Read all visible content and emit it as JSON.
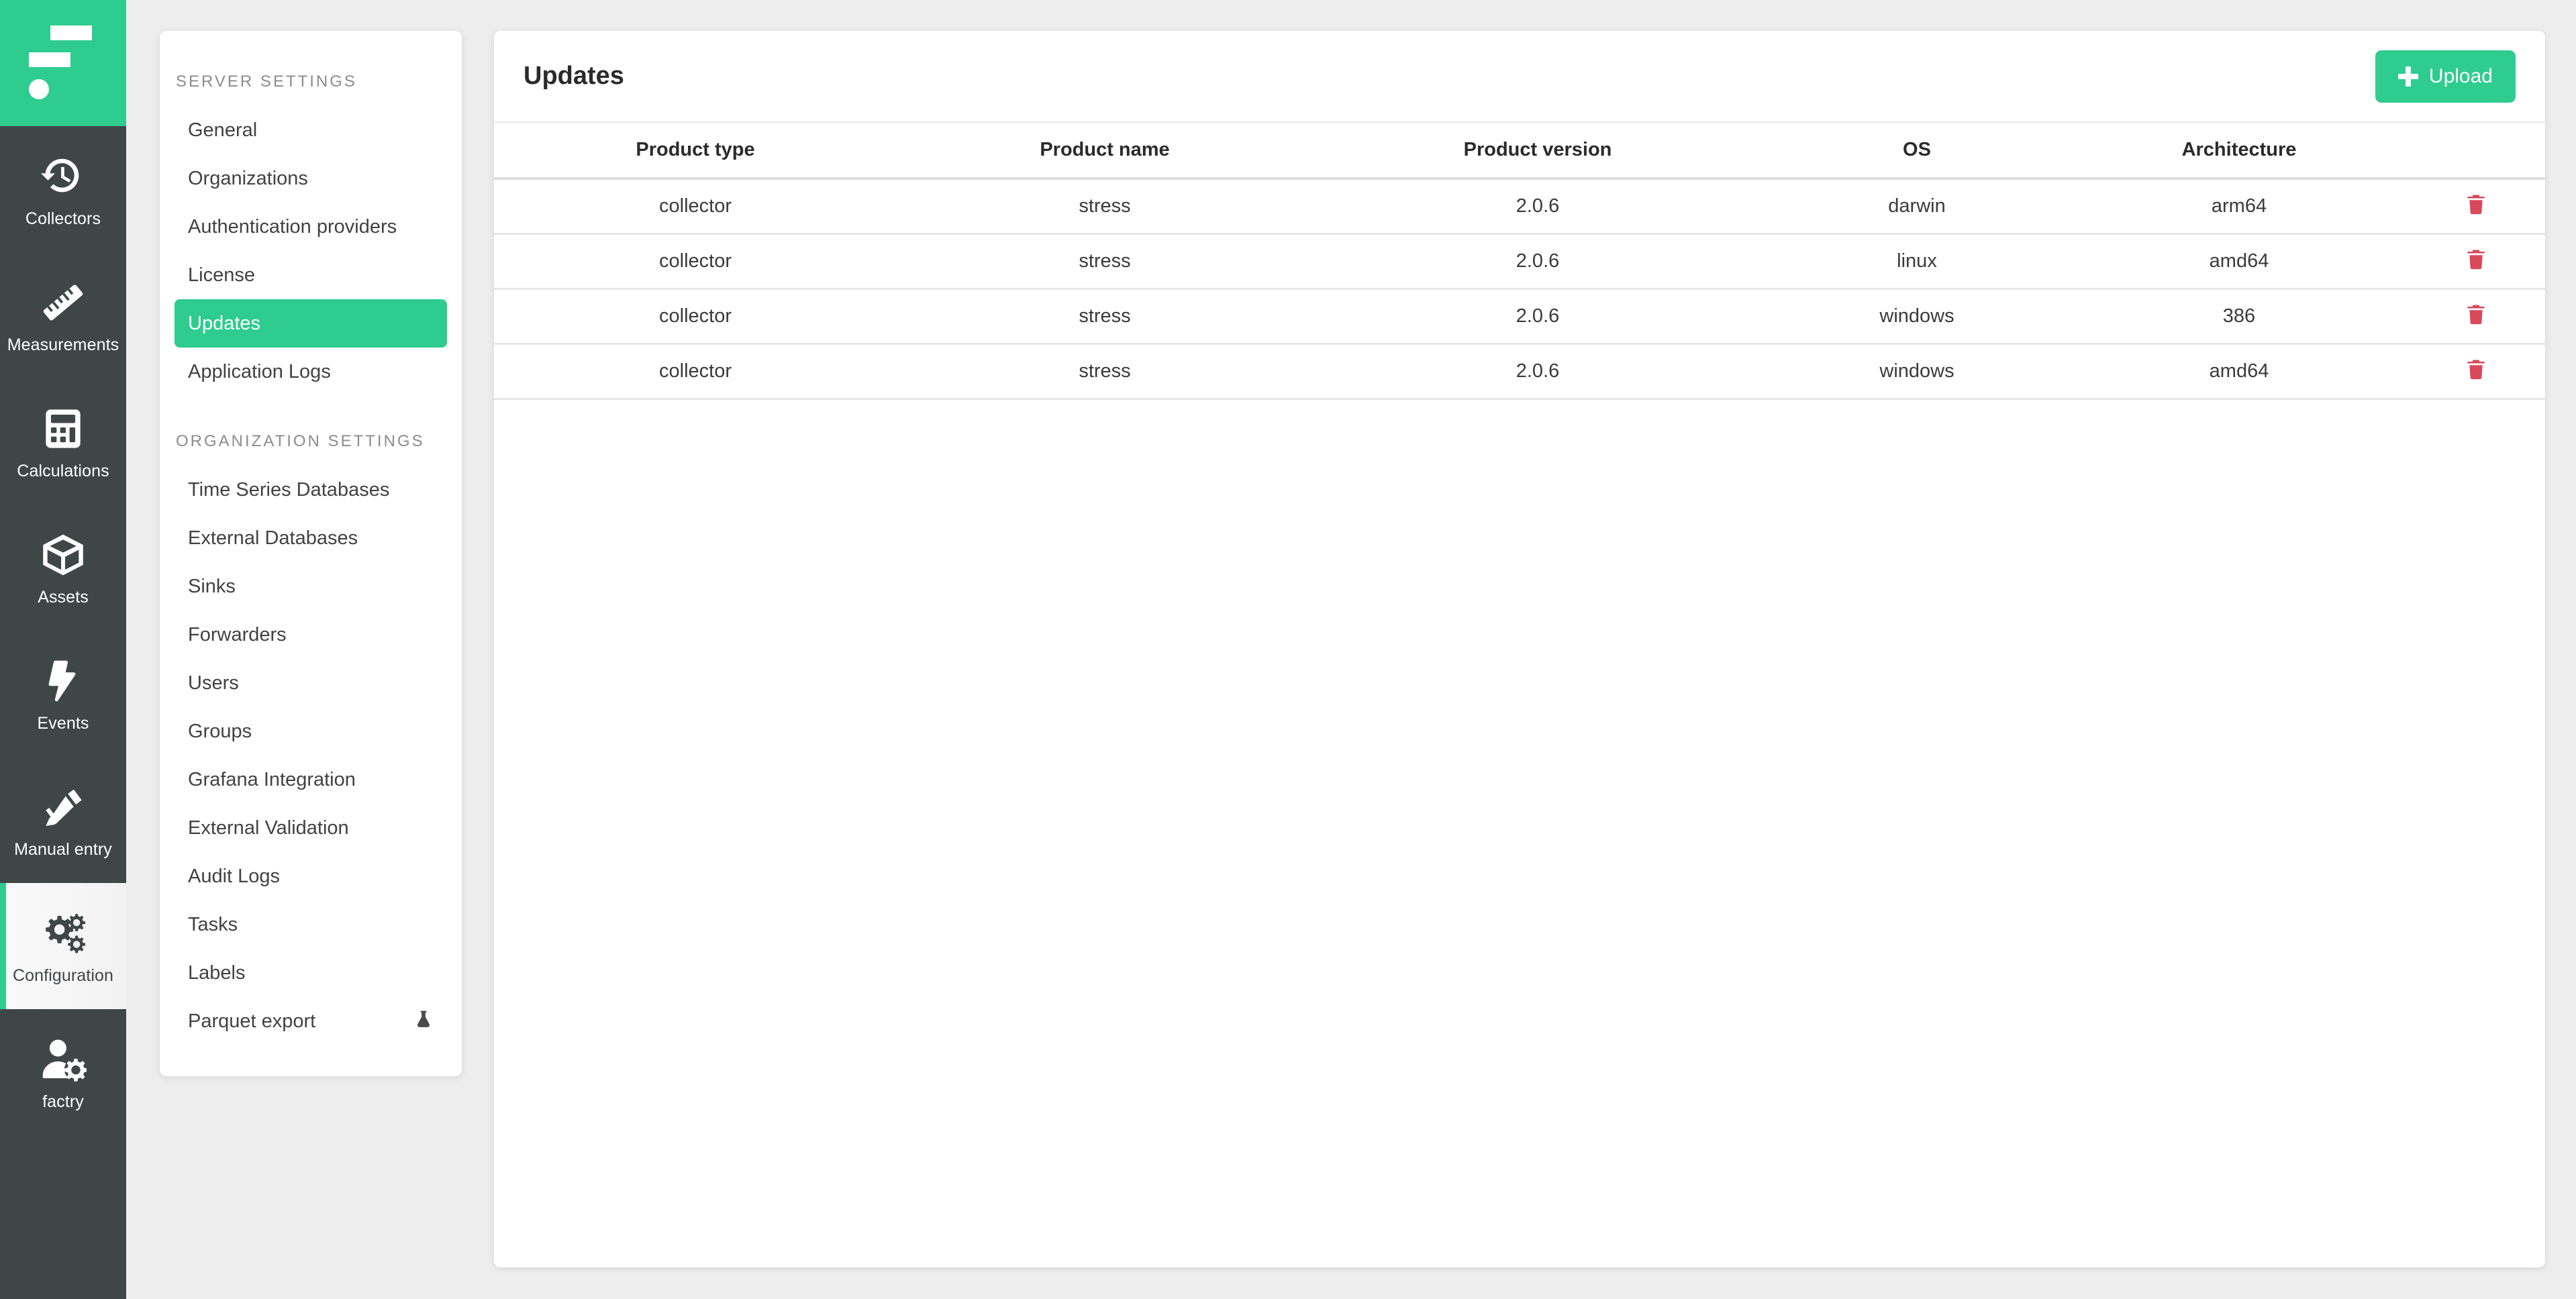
{
  "brand": {
    "logo_name": "factry-logo",
    "accent_color": "#2ecc8f",
    "rail_color": "#3f4746",
    "danger_color": "#d9485b"
  },
  "rail": {
    "items": [
      {
        "label": "Collectors",
        "icon": "history-clock-icon",
        "active": false
      },
      {
        "label": "Measurements",
        "icon": "ruler-icon",
        "active": false
      },
      {
        "label": "Calculations",
        "icon": "calculator-icon",
        "active": false
      },
      {
        "label": "Assets",
        "icon": "cube-icon",
        "active": false
      },
      {
        "label": "Events",
        "icon": "lightning-bolt-icon",
        "active": false
      },
      {
        "label": "Manual entry",
        "icon": "pencil-icon",
        "active": false
      },
      {
        "label": "Configuration",
        "icon": "gears-icon",
        "active": true
      },
      {
        "label": "factry",
        "icon": "user-gear-icon",
        "active": false
      }
    ]
  },
  "settings": {
    "groups": [
      {
        "title": "SERVER SETTINGS",
        "items": [
          {
            "label": "General",
            "active": false,
            "icon": null
          },
          {
            "label": "Organizations",
            "active": false,
            "icon": null
          },
          {
            "label": "Authentication providers",
            "active": false,
            "icon": null
          },
          {
            "label": "License",
            "active": false,
            "icon": null
          },
          {
            "label": "Updates",
            "active": true,
            "icon": null
          },
          {
            "label": "Application Logs",
            "active": false,
            "icon": null
          }
        ]
      },
      {
        "title": "ORGANIZATION SETTINGS",
        "items": [
          {
            "label": "Time Series Databases",
            "active": false,
            "icon": null
          },
          {
            "label": "External Databases",
            "active": false,
            "icon": null
          },
          {
            "label": "Sinks",
            "active": false,
            "icon": null
          },
          {
            "label": "Forwarders",
            "active": false,
            "icon": null
          },
          {
            "label": "Users",
            "active": false,
            "icon": null
          },
          {
            "label": "Groups",
            "active": false,
            "icon": null
          },
          {
            "label": "Grafana Integration",
            "active": false,
            "icon": null
          },
          {
            "label": "External Validation",
            "active": false,
            "icon": null
          },
          {
            "label": "Audit Logs",
            "active": false,
            "icon": null
          },
          {
            "label": "Tasks",
            "active": false,
            "icon": null
          },
          {
            "label": "Labels",
            "active": false,
            "icon": null
          },
          {
            "label": "Parquet export",
            "active": false,
            "icon": "flask-icon"
          }
        ]
      }
    ]
  },
  "main": {
    "title": "Updates",
    "upload_label": "Upload",
    "upload_icon": "plus-icon",
    "table": {
      "columns": [
        "Product type",
        "Product name",
        "Product version",
        "OS",
        "Architecture",
        ""
      ],
      "rows": [
        {
          "product_type": "collector",
          "product_name": "stress",
          "product_version": "2.0.6",
          "os": "darwin",
          "architecture": "arm64"
        },
        {
          "product_type": "collector",
          "product_name": "stress",
          "product_version": "2.0.6",
          "os": "linux",
          "architecture": "amd64"
        },
        {
          "product_type": "collector",
          "product_name": "stress",
          "product_version": "2.0.6",
          "os": "windows",
          "architecture": "386"
        },
        {
          "product_type": "collector",
          "product_name": "stress",
          "product_version": "2.0.6",
          "os": "windows",
          "architecture": "amd64"
        }
      ],
      "row_action_icon": "trash-icon"
    }
  }
}
